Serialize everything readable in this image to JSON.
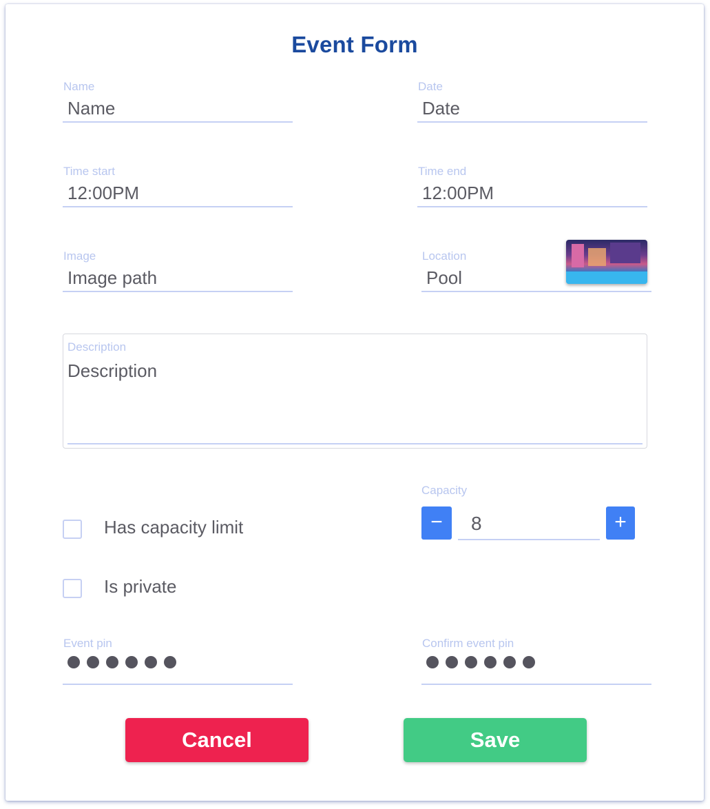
{
  "form": {
    "title": "Event Form",
    "name": {
      "label": "Name",
      "value": "Name"
    },
    "date": {
      "label": "Date",
      "value": "Date"
    },
    "time_start": {
      "label": "Time start",
      "value": "12:00PM"
    },
    "time_end": {
      "label": "Time end",
      "value": "12:00PM"
    },
    "image": {
      "label": "Image",
      "value": "Image path"
    },
    "location": {
      "label": "Location",
      "value": "Pool",
      "thumbnail_icon": "pool-photo"
    },
    "description": {
      "label": "Description",
      "value": "Description"
    },
    "has_capacity_limit": {
      "label": "Has capacity limit",
      "checked": false
    },
    "is_private": {
      "label": "Is private",
      "checked": false
    },
    "capacity": {
      "label": "Capacity",
      "value": "8",
      "decrement_symbol": "−",
      "increment_symbol": "+"
    },
    "event_pin": {
      "label": "Event pin",
      "masked_length": 6
    },
    "confirm_event_pin": {
      "label": "Confirm event pin",
      "masked_length": 6
    },
    "cancel_label": "Cancel",
    "save_label": "Save"
  },
  "colors": {
    "title": "#1b4a9e",
    "label": "#b8c6ef",
    "accent": "#4080f5",
    "cancel": "#ee224f",
    "save": "#42cb85"
  }
}
